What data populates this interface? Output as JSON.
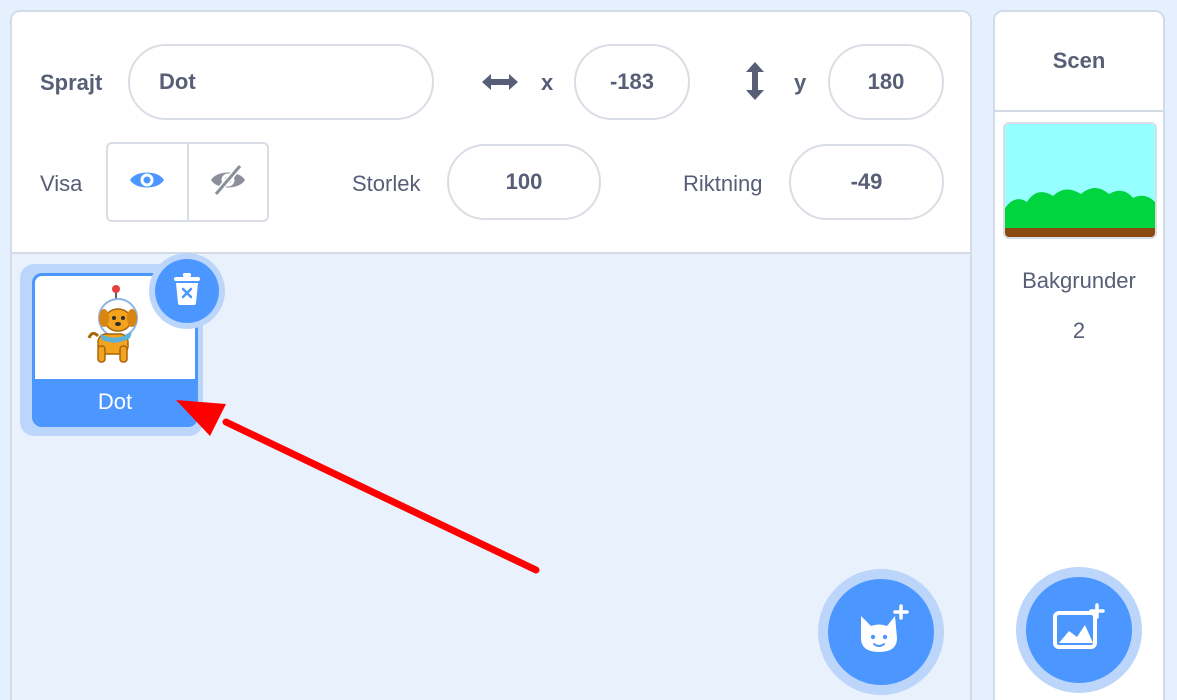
{
  "sprite_info": {
    "sprite_label": "Sprajt",
    "sprite_name": "Dot",
    "x_label": "x",
    "x_value": "-183",
    "y_label": "y",
    "y_value": "180",
    "show_label": "Visa",
    "size_label": "Storlek",
    "size_value": "100",
    "direction_label": "Riktning",
    "direction_value": "-49"
  },
  "sprites": [
    {
      "name": "Dot",
      "selected": true,
      "thumbnail_icon": "dot-dog-icon"
    }
  ],
  "stage": {
    "header": "Scen",
    "backdrops_label": "Bakgrunder",
    "backdrops_count": "2"
  },
  "icons": {
    "x_axis": "horizontal-arrows-icon",
    "y_axis": "vertical-arrows-icon",
    "show": "eye-icon",
    "hide": "eye-slash-icon",
    "delete": "trash-icon",
    "add_sprite": "add-sprite-cat-icon",
    "add_backdrop": "add-backdrop-image-icon"
  },
  "annotation": {
    "type": "red-arrow",
    "points_to": "sprite-tile-dot",
    "color": "#ff0000"
  },
  "colors": {
    "accent": "#4c97ff",
    "accent_light": "#bcd6fb",
    "text": "#575e75",
    "pane_bg": "#e9f1fc",
    "page_bg": "#e5f0ff"
  }
}
